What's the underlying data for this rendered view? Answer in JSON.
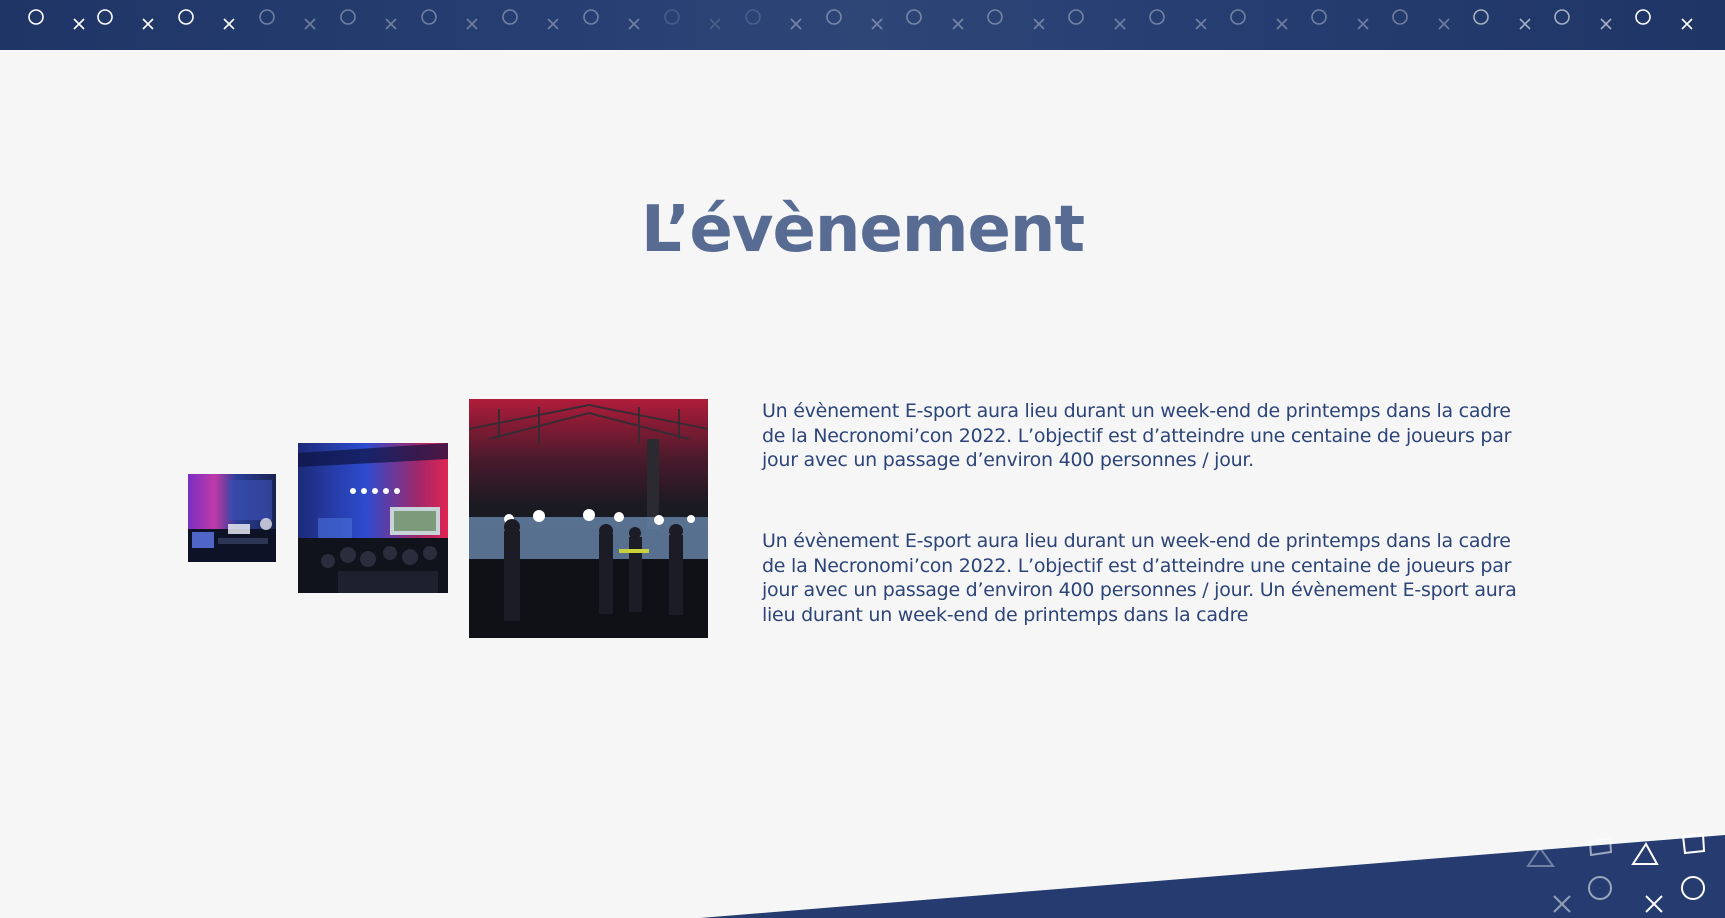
{
  "slide": {
    "title": "L’évènement",
    "paragraphs": [
      "Un évènement E-sport aura lieu durant un week-end de printemps dans la cadre de la Necronomi’con 2022. L’objectif est d’atteindre une centaine de joueurs par jour avec un passage d’environ 400 personnes / jour.",
      "Un évènement E-sport aura lieu durant un week-end de printemps dans la cadre de la Necronomi’con 2022. L’objectif est d’atteindre une centaine de joueurs par jour avec un passage d’environ 400 personnes / jour. Un évènement E-sport aura lieu durant un week-end de printemps dans la cadre"
    ]
  },
  "decor": {
    "banner_pattern": [
      "circle-icon",
      "cross-icon"
    ],
    "corner_pattern": [
      "triangle-icon",
      "square-icon",
      "circle-icon",
      "cross-icon"
    ]
  },
  "colors": {
    "navy": "#243a6e",
    "title": "#586b92",
    "text": "#2c4478",
    "background": "#f6f6f6"
  },
  "photos": [
    "esports-stage-photo",
    "esports-crowd-photo",
    "esports-hall-photo"
  ]
}
